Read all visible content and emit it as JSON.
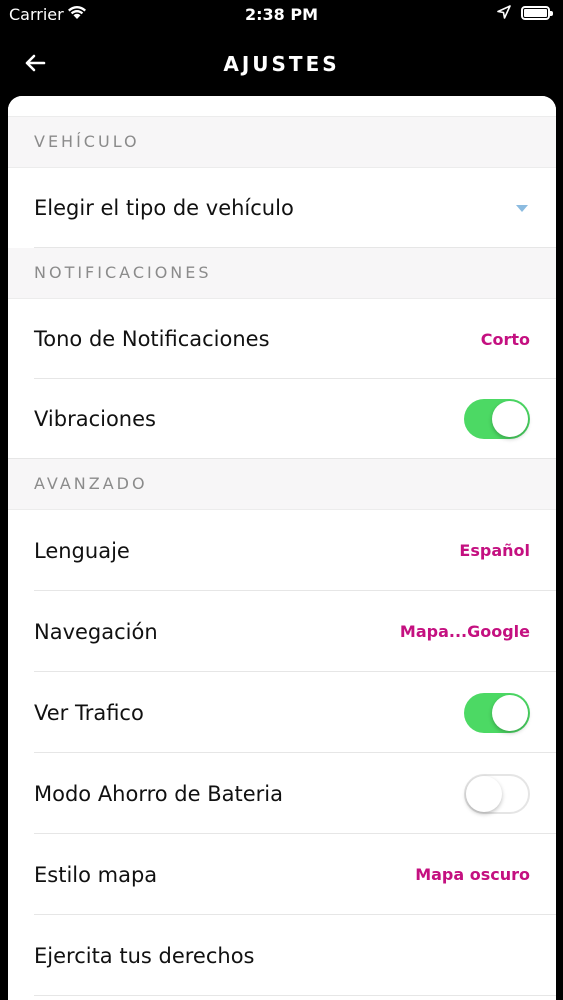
{
  "status_bar": {
    "carrier": "Carrier",
    "time": "2:38 PM"
  },
  "nav": {
    "title": "AJUSTES"
  },
  "sections": {
    "vehiculo": {
      "header": "VEHÍCULO",
      "rows": [
        {
          "label": "Elegir el tipo de vehículo"
        }
      ]
    },
    "notificaciones": {
      "header": "NOTIFICACIONES",
      "rows": [
        {
          "label": "Tono de Notificaciones",
          "value": "Corto"
        },
        {
          "label": "Vibraciones",
          "toggle": true
        }
      ]
    },
    "avanzado": {
      "header": "AVANZADO",
      "rows": [
        {
          "label": "Lenguaje",
          "value": "Español"
        },
        {
          "label": "Navegación",
          "value": "Mapa...Google"
        },
        {
          "label": "Ver Trafico",
          "toggle": true
        },
        {
          "label": "Modo Ahorro de Bateria",
          "toggle": false
        },
        {
          "label": "Estilo mapa",
          "value": "Mapa oscuro"
        },
        {
          "label": "Ejercita tus derechos"
        }
      ]
    }
  },
  "colors": {
    "accent": "#c41080",
    "toggle_on": "#4cd964",
    "header_bg": "#f7f6f7"
  }
}
